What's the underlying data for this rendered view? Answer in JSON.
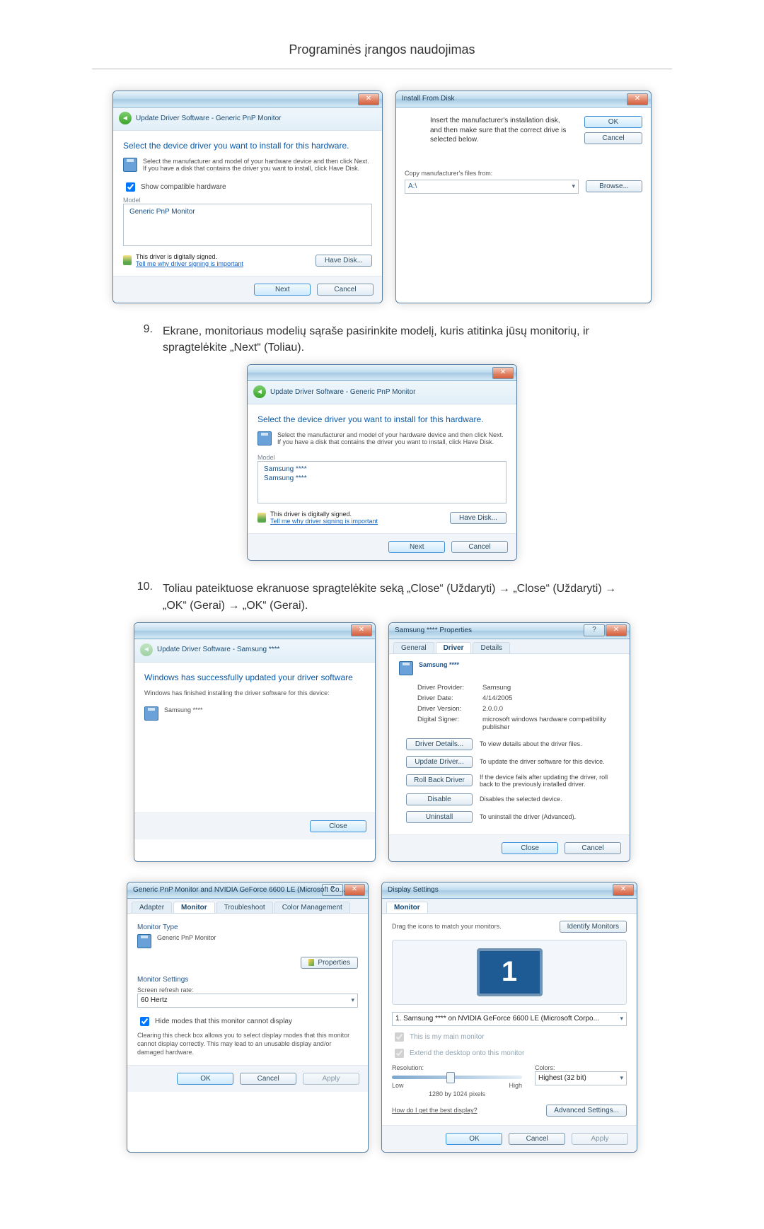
{
  "page_title": "Programinės įrangos naudojimas",
  "dialog_update_a": {
    "breadcrumb": "Update Driver Software - Generic PnP Monitor",
    "heading": "Select the device driver you want to install for this hardware.",
    "hint": "Select the manufacturer and model of your hardware device and then click Next. If you have a disk that contains the driver you want to install, click Have Disk.",
    "show_compatible": "Show compatible hardware",
    "model_label": "Model",
    "model_item": "Generic PnP Monitor",
    "signed": "This driver is digitally signed.",
    "signed_link": "Tell me why driver signing is important",
    "have_disk": "Have Disk...",
    "next": "Next",
    "cancel": "Cancel"
  },
  "dialog_install_from_disk": {
    "title": "Install From Disk",
    "msg": "Insert the manufacturer's installation disk, and then make sure that the correct drive is selected below.",
    "ok": "OK",
    "cancel": "Cancel",
    "copy_label": "Copy manufacturer's files from:",
    "copy_path": "A:\\",
    "browse": "Browse..."
  },
  "step_9_num": "9.",
  "step_9_text": "Ekrane, monitoriaus modelių sąraše pasirinkite modelį, kuris atitinka jūsų monitorių, ir spragtelėkite „Next“ (Toliau).",
  "dialog_update_b": {
    "breadcrumb": "Update Driver Software - Generic PnP Monitor",
    "heading": "Select the device driver you want to install for this hardware.",
    "hint": "Select the manufacturer and model of your hardware device and then click Next. If you have a disk that contains the driver you want to install, click Have Disk.",
    "model_label": "Model",
    "model_item_1": "Samsung ****",
    "model_item_2": "Samsung ****",
    "signed": "This driver is digitally signed.",
    "signed_link": "Tell me why driver signing is important",
    "have_disk": "Have Disk...",
    "next": "Next",
    "cancel": "Cancel"
  },
  "step_10_num": "10.",
  "step_10_text": "Toliau pateiktuose ekranuose spragtelėkite seką „Close“ (Uždaryti) → „Close“ (Uždaryti) → „OK“ (Gerai) → „OK“ (Gerai).",
  "dialog_update_done": {
    "breadcrumb": "Update Driver Software - Samsung ****",
    "heading": "Windows has successfully updated your driver software",
    "sub": "Windows has finished installing the driver software for this device:",
    "device": "Samsung ****",
    "close": "Close"
  },
  "dialog_properties": {
    "title": "Samsung **** Properties",
    "tab_general": "General",
    "tab_driver": "Driver",
    "tab_details": "Details",
    "device": "Samsung ****",
    "prov_k": "Driver Provider:",
    "prov_v": "Samsung",
    "date_k": "Driver Date:",
    "date_v": "4/14/2005",
    "ver_k": "Driver Version:",
    "ver_v": "2.0.0.0",
    "sig_k": "Digital Signer:",
    "sig_v": "microsoft windows hardware compatibility publisher",
    "btn_details": "Driver Details...",
    "btn_details_desc": "To view details about the driver files.",
    "btn_update": "Update Driver...",
    "btn_update_desc": "To update the driver software for this device.",
    "btn_roll": "Roll Back Driver",
    "btn_roll_desc": "If the device fails after updating the driver, roll back to the previously installed driver.",
    "btn_disable": "Disable",
    "btn_disable_desc": "Disables the selected device.",
    "btn_uninstall": "Uninstall",
    "btn_uninstall_desc": "To uninstall the driver (Advanced).",
    "close": "Close",
    "cancel": "Cancel"
  },
  "dialog_gpu": {
    "title": "Generic PnP Monitor and NVIDIA GeForce 6600 LE (Microsoft Co...",
    "tab_adapter": "Adapter",
    "tab_monitor": "Monitor",
    "tab_troubleshoot": "Troubleshoot",
    "tab_color": "Color Management",
    "mtype_label": "Monitor Type",
    "mtype_value": "Generic PnP Monitor",
    "properties": "Properties",
    "msettings_label": "Monitor Settings",
    "refresh_label": "Screen refresh rate:",
    "refresh_value": "60 Hertz",
    "hide_modes": "Hide modes that this monitor cannot display",
    "hide_desc": "Clearing this check box allows you to select display modes that this monitor cannot display correctly. This may lead to an unusable display and/or damaged hardware.",
    "ok": "OK",
    "cancel": "Cancel",
    "apply": "Apply"
  },
  "dialog_display": {
    "title": "Display Settings",
    "tab_monitor": "Monitor",
    "drag": "Drag the icons to match your monitors.",
    "identify": "Identify Monitors",
    "sel_monitor": "1. Samsung **** on NVIDIA GeForce 6600 LE (Microsoft Corpo...",
    "main_chk": "This is my main monitor",
    "extend_chk": "Extend the desktop onto this monitor",
    "res_label": "Resolution:",
    "res_low": "Low",
    "res_high": "High",
    "res_value": "1280 by 1024 pixels",
    "colors_label": "Colors:",
    "colors_value": "Highest (32 bit)",
    "best_link": "How do I get the best display?",
    "advanced": "Advanced Settings...",
    "ok": "OK",
    "cancel": "Cancel",
    "apply": "Apply"
  }
}
